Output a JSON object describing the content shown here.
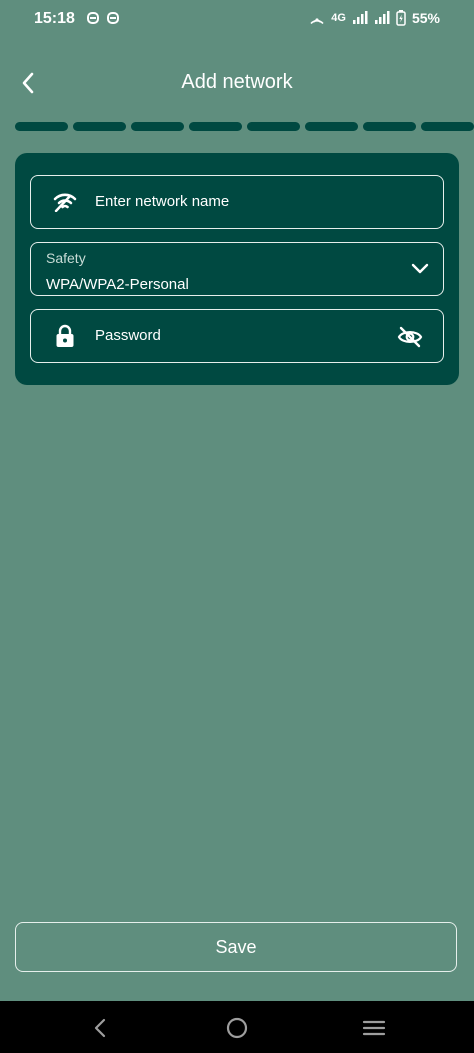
{
  "status_bar": {
    "time": "15:18",
    "network_type": "4G",
    "battery": "55%"
  },
  "app_bar": {
    "title": "Add network",
    "back_icon": "chevron-left-icon"
  },
  "progress": {
    "segments": 9,
    "color": "#004941"
  },
  "form": {
    "network_name": {
      "placeholder": "Enter network name",
      "value": "",
      "icon": "wifi-icon"
    },
    "safety": {
      "label": "Safety",
      "value": "WPA/WPA2-Personal",
      "icon": "chevron-down-icon"
    },
    "password": {
      "placeholder": "Password",
      "value": "",
      "icon": "lock-icon",
      "toggle_icon": "eye-off-icon"
    }
  },
  "actions": {
    "save_label": "Save"
  },
  "colors": {
    "background": "#5f8e7e",
    "card": "#004941",
    "text": "#ffffff"
  }
}
